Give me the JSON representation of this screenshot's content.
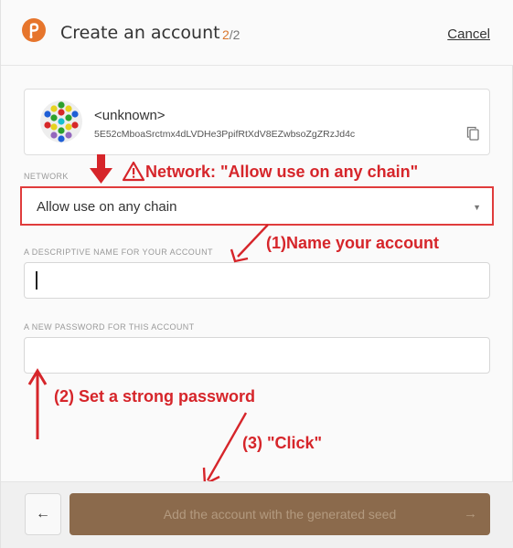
{
  "header": {
    "title": "Create an account",
    "step_current": "2",
    "step_total": "/2",
    "cancel_label": "Cancel",
    "brand_color": "#e6752c"
  },
  "account": {
    "name": "<unknown>",
    "address": "5E52cMboaSrctmx4dLVDHe3PpifRtXdV8EZwbsoZgZRzJd4c",
    "copy_icon": "copy-icon"
  },
  "network": {
    "label": "NETWORK",
    "value": "Allow use on any chain"
  },
  "name_field": {
    "label": "A DESCRIPTIVE NAME FOR YOUR ACCOUNT",
    "value": ""
  },
  "password_field": {
    "label": "A NEW PASSWORD FOR THIS ACCOUNT",
    "value": ""
  },
  "annotations": {
    "network": "Network: \"Allow use on any chain\"",
    "name": "(1)Name your account",
    "password": "(2) Set a strong password",
    "click": "(3) \"Click\"",
    "color": "#d6252a"
  },
  "footer": {
    "back_icon": "arrow-left-icon",
    "back_glyph": "←",
    "submit_label": "Add the account with the generated seed",
    "submit_arrow": "→"
  }
}
